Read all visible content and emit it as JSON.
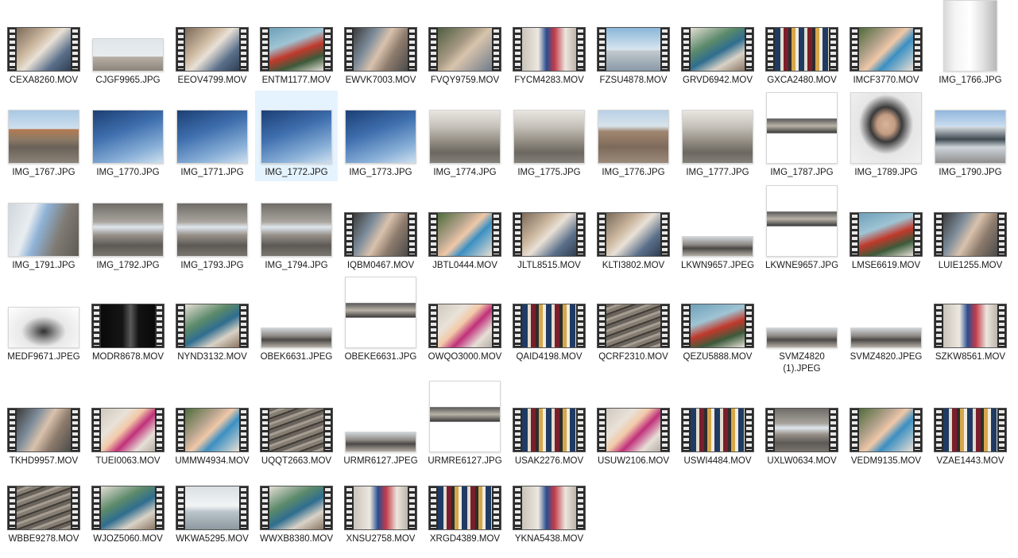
{
  "files": [
    {
      "name": "CEXA8260.MOV",
      "kind": "video",
      "scene": "people-couch"
    },
    {
      "name": "CJGF9965.JPG",
      "kind": "photo",
      "scene": "man-station"
    },
    {
      "name": "EEOV4799.MOV",
      "kind": "video",
      "scene": "people-couch"
    },
    {
      "name": "ENTM1177.MOV",
      "kind": "video",
      "scene": "moto"
    },
    {
      "name": "EWVK7003.MOV",
      "kind": "video",
      "scene": "woman-glasses"
    },
    {
      "name": "FVQY9759.MOV",
      "kind": "video",
      "scene": "woman-sweater"
    },
    {
      "name": "FYCM4283.MOV",
      "kind": "video",
      "scene": "girl-dress"
    },
    {
      "name": "FZSU4878.MOV",
      "kind": "video",
      "scene": "harbor"
    },
    {
      "name": "GRVD6942.MOV",
      "kind": "video",
      "scene": "bike"
    },
    {
      "name": "GXCA2480.MOV",
      "kind": "video",
      "scene": "books"
    },
    {
      "name": "IMCF3770.MOV",
      "kind": "video",
      "scene": "child-blue"
    },
    {
      "name": "IMG_1766.JPG",
      "kind": "photo",
      "scene": "ticket"
    },
    {
      "name": "IMG_1767.JPG",
      "kind": "photo",
      "scene": "rails-building"
    },
    {
      "name": "IMG_1770.JPG",
      "kind": "photo",
      "scene": "sky-wires"
    },
    {
      "name": "IMG_1771.JPG",
      "kind": "photo",
      "scene": "sky-wires"
    },
    {
      "name": "IMG_1772.JPG",
      "kind": "photo",
      "scene": "sky-wires",
      "selected": true
    },
    {
      "name": "IMG_1773.JPG",
      "kind": "photo",
      "scene": "sky-wires"
    },
    {
      "name": "IMG_1774.JPG",
      "kind": "photo",
      "scene": "platform-sun"
    },
    {
      "name": "IMG_1775.JPG",
      "kind": "photo",
      "scene": "platform-sun"
    },
    {
      "name": "IMG_1776.JPG",
      "kind": "photo",
      "scene": "platform-cobble"
    },
    {
      "name": "IMG_1777.JPG",
      "kind": "photo",
      "scene": "platform-sun"
    },
    {
      "name": "IMG_1787.JPG",
      "kind": "photo",
      "scene": "pano-white"
    },
    {
      "name": "IMG_1789.JPG",
      "kind": "photo",
      "scene": "man-portrait"
    },
    {
      "name": "IMG_1790.JPG",
      "kind": "photo",
      "scene": "train"
    },
    {
      "name": "IMG_1791.JPG",
      "kind": "photo",
      "scene": "train-platform"
    },
    {
      "name": "IMG_1792.JPG",
      "kind": "photo",
      "scene": "canopy"
    },
    {
      "name": "IMG_1793.JPG",
      "kind": "photo",
      "scene": "canopy"
    },
    {
      "name": "IMG_1794.JPG",
      "kind": "photo",
      "scene": "canopy"
    },
    {
      "name": "IQBM0467.MOV",
      "kind": "video",
      "scene": "woman-glasses"
    },
    {
      "name": "JBTL0444.MOV",
      "kind": "video",
      "scene": "child-blue"
    },
    {
      "name": "JLTL8515.MOV",
      "kind": "video",
      "scene": "people-couch"
    },
    {
      "name": "KLTI3802.MOV",
      "kind": "video",
      "scene": "people-couch"
    },
    {
      "name": "LKWN9657.JPEG",
      "kind": "photo",
      "scene": "pano-strip"
    },
    {
      "name": "LKWNE9657.JPG",
      "kind": "photo",
      "scene": "pano-white"
    },
    {
      "name": "LMSE6619.MOV",
      "kind": "video",
      "scene": "moto"
    },
    {
      "name": "LUIE1255.MOV",
      "kind": "video",
      "scene": "woman-glasses"
    },
    {
      "name": "MEDF9671.JPEG",
      "kind": "photo",
      "scene": "car"
    },
    {
      "name": "MODR8678.MOV",
      "kind": "video",
      "scene": "dark"
    },
    {
      "name": "NYND3132.MOV",
      "kind": "video",
      "scene": "bike"
    },
    {
      "name": "OBEK6631.JPEG",
      "kind": "photo",
      "scene": "pano-strip"
    },
    {
      "name": "OBEKE6631.JPG",
      "kind": "photo",
      "scene": "pano-white"
    },
    {
      "name": "OWQO3000.MOV",
      "kind": "video",
      "scene": "child-pink"
    },
    {
      "name": "QAID4198.MOV",
      "kind": "video",
      "scene": "books"
    },
    {
      "name": "QCRF2310.MOV",
      "kind": "video",
      "scene": "tracks"
    },
    {
      "name": "QEZU5888.MOV",
      "kind": "video",
      "scene": "moto"
    },
    {
      "name": "SVMZ4820 (1).JPEG",
      "kind": "photo",
      "scene": "pano-strip"
    },
    {
      "name": "SVMZ4820.JPEG",
      "kind": "photo",
      "scene": "pano-strip"
    },
    {
      "name": "SZKW8561.MOV",
      "kind": "video",
      "scene": "girl-dress"
    },
    {
      "name": "TKHD9957.MOV",
      "kind": "video",
      "scene": "woman-glasses"
    },
    {
      "name": "TUEI0063.MOV",
      "kind": "video",
      "scene": "child-pink"
    },
    {
      "name": "UMMW4934.MOV",
      "kind": "video",
      "scene": "child-blue"
    },
    {
      "name": "UQQT2663.MOV",
      "kind": "video",
      "scene": "tracks"
    },
    {
      "name": "URMR6127.JPEG",
      "kind": "photo",
      "scene": "pano-strip"
    },
    {
      "name": "URMRE6127.JPG",
      "kind": "photo",
      "scene": "pano-white"
    },
    {
      "name": "USAK2276.MOV",
      "kind": "video",
      "scene": "books"
    },
    {
      "name": "USUW2106.MOV",
      "kind": "video",
      "scene": "child-pink"
    },
    {
      "name": "USWI4484.MOV",
      "kind": "video",
      "scene": "books"
    },
    {
      "name": "UXLW0634.MOV",
      "kind": "video",
      "scene": "canopy"
    },
    {
      "name": "VEDM9135.MOV",
      "kind": "video",
      "scene": "child-blue"
    },
    {
      "name": "VZAE1443.MOV",
      "kind": "video",
      "scene": "books"
    },
    {
      "name": "WBBE9278.MOV",
      "kind": "video",
      "scene": "tracks"
    },
    {
      "name": "WJOZ5060.MOV",
      "kind": "video",
      "scene": "bike"
    },
    {
      "name": "WKWA5295.MOV",
      "kind": "video",
      "scene": "window"
    },
    {
      "name": "WWXB8380.MOV",
      "kind": "video",
      "scene": "bike"
    },
    {
      "name": "XNSU2758.MOV",
      "kind": "video",
      "scene": "girl-dress"
    },
    {
      "name": "XRGD4389.MOV",
      "kind": "video",
      "scene": "books"
    },
    {
      "name": "YKNA5438.MOV",
      "kind": "video",
      "scene": "girl-dress"
    }
  ]
}
